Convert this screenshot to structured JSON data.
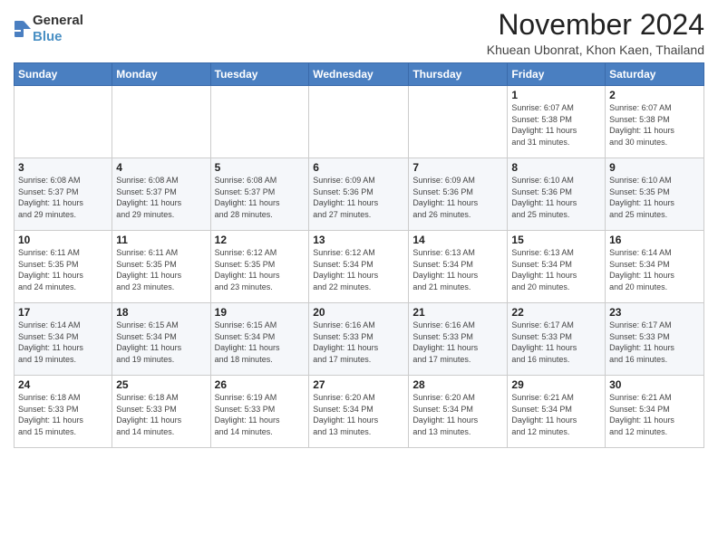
{
  "logo": {
    "text_general": "General",
    "text_blue": "Blue"
  },
  "header": {
    "month": "November 2024",
    "location": "Khuean Ubonrat, Khon Kaen, Thailand"
  },
  "weekdays": [
    "Sunday",
    "Monday",
    "Tuesday",
    "Wednesday",
    "Thursday",
    "Friday",
    "Saturday"
  ],
  "weeks": [
    [
      {
        "day": "",
        "info": ""
      },
      {
        "day": "",
        "info": ""
      },
      {
        "day": "",
        "info": ""
      },
      {
        "day": "",
        "info": ""
      },
      {
        "day": "",
        "info": ""
      },
      {
        "day": "1",
        "info": "Sunrise: 6:07 AM\nSunset: 5:38 PM\nDaylight: 11 hours\nand 31 minutes."
      },
      {
        "day": "2",
        "info": "Sunrise: 6:07 AM\nSunset: 5:38 PM\nDaylight: 11 hours\nand 30 minutes."
      }
    ],
    [
      {
        "day": "3",
        "info": "Sunrise: 6:08 AM\nSunset: 5:37 PM\nDaylight: 11 hours\nand 29 minutes."
      },
      {
        "day": "4",
        "info": "Sunrise: 6:08 AM\nSunset: 5:37 PM\nDaylight: 11 hours\nand 29 minutes."
      },
      {
        "day": "5",
        "info": "Sunrise: 6:08 AM\nSunset: 5:37 PM\nDaylight: 11 hours\nand 28 minutes."
      },
      {
        "day": "6",
        "info": "Sunrise: 6:09 AM\nSunset: 5:36 PM\nDaylight: 11 hours\nand 27 minutes."
      },
      {
        "day": "7",
        "info": "Sunrise: 6:09 AM\nSunset: 5:36 PM\nDaylight: 11 hours\nand 26 minutes."
      },
      {
        "day": "8",
        "info": "Sunrise: 6:10 AM\nSunset: 5:36 PM\nDaylight: 11 hours\nand 25 minutes."
      },
      {
        "day": "9",
        "info": "Sunrise: 6:10 AM\nSunset: 5:35 PM\nDaylight: 11 hours\nand 25 minutes."
      }
    ],
    [
      {
        "day": "10",
        "info": "Sunrise: 6:11 AM\nSunset: 5:35 PM\nDaylight: 11 hours\nand 24 minutes."
      },
      {
        "day": "11",
        "info": "Sunrise: 6:11 AM\nSunset: 5:35 PM\nDaylight: 11 hours\nand 23 minutes."
      },
      {
        "day": "12",
        "info": "Sunrise: 6:12 AM\nSunset: 5:35 PM\nDaylight: 11 hours\nand 23 minutes."
      },
      {
        "day": "13",
        "info": "Sunrise: 6:12 AM\nSunset: 5:34 PM\nDaylight: 11 hours\nand 22 minutes."
      },
      {
        "day": "14",
        "info": "Sunrise: 6:13 AM\nSunset: 5:34 PM\nDaylight: 11 hours\nand 21 minutes."
      },
      {
        "day": "15",
        "info": "Sunrise: 6:13 AM\nSunset: 5:34 PM\nDaylight: 11 hours\nand 20 minutes."
      },
      {
        "day": "16",
        "info": "Sunrise: 6:14 AM\nSunset: 5:34 PM\nDaylight: 11 hours\nand 20 minutes."
      }
    ],
    [
      {
        "day": "17",
        "info": "Sunrise: 6:14 AM\nSunset: 5:34 PM\nDaylight: 11 hours\nand 19 minutes."
      },
      {
        "day": "18",
        "info": "Sunrise: 6:15 AM\nSunset: 5:34 PM\nDaylight: 11 hours\nand 19 minutes."
      },
      {
        "day": "19",
        "info": "Sunrise: 6:15 AM\nSunset: 5:34 PM\nDaylight: 11 hours\nand 18 minutes."
      },
      {
        "day": "20",
        "info": "Sunrise: 6:16 AM\nSunset: 5:33 PM\nDaylight: 11 hours\nand 17 minutes."
      },
      {
        "day": "21",
        "info": "Sunrise: 6:16 AM\nSunset: 5:33 PM\nDaylight: 11 hours\nand 17 minutes."
      },
      {
        "day": "22",
        "info": "Sunrise: 6:17 AM\nSunset: 5:33 PM\nDaylight: 11 hours\nand 16 minutes."
      },
      {
        "day": "23",
        "info": "Sunrise: 6:17 AM\nSunset: 5:33 PM\nDaylight: 11 hours\nand 16 minutes."
      }
    ],
    [
      {
        "day": "24",
        "info": "Sunrise: 6:18 AM\nSunset: 5:33 PM\nDaylight: 11 hours\nand 15 minutes."
      },
      {
        "day": "25",
        "info": "Sunrise: 6:18 AM\nSunset: 5:33 PM\nDaylight: 11 hours\nand 14 minutes."
      },
      {
        "day": "26",
        "info": "Sunrise: 6:19 AM\nSunset: 5:33 PM\nDaylight: 11 hours\nand 14 minutes."
      },
      {
        "day": "27",
        "info": "Sunrise: 6:20 AM\nSunset: 5:34 PM\nDaylight: 11 hours\nand 13 minutes."
      },
      {
        "day": "28",
        "info": "Sunrise: 6:20 AM\nSunset: 5:34 PM\nDaylight: 11 hours\nand 13 minutes."
      },
      {
        "day": "29",
        "info": "Sunrise: 6:21 AM\nSunset: 5:34 PM\nDaylight: 11 hours\nand 12 minutes."
      },
      {
        "day": "30",
        "info": "Sunrise: 6:21 AM\nSunset: 5:34 PM\nDaylight: 11 hours\nand 12 minutes."
      }
    ]
  ]
}
